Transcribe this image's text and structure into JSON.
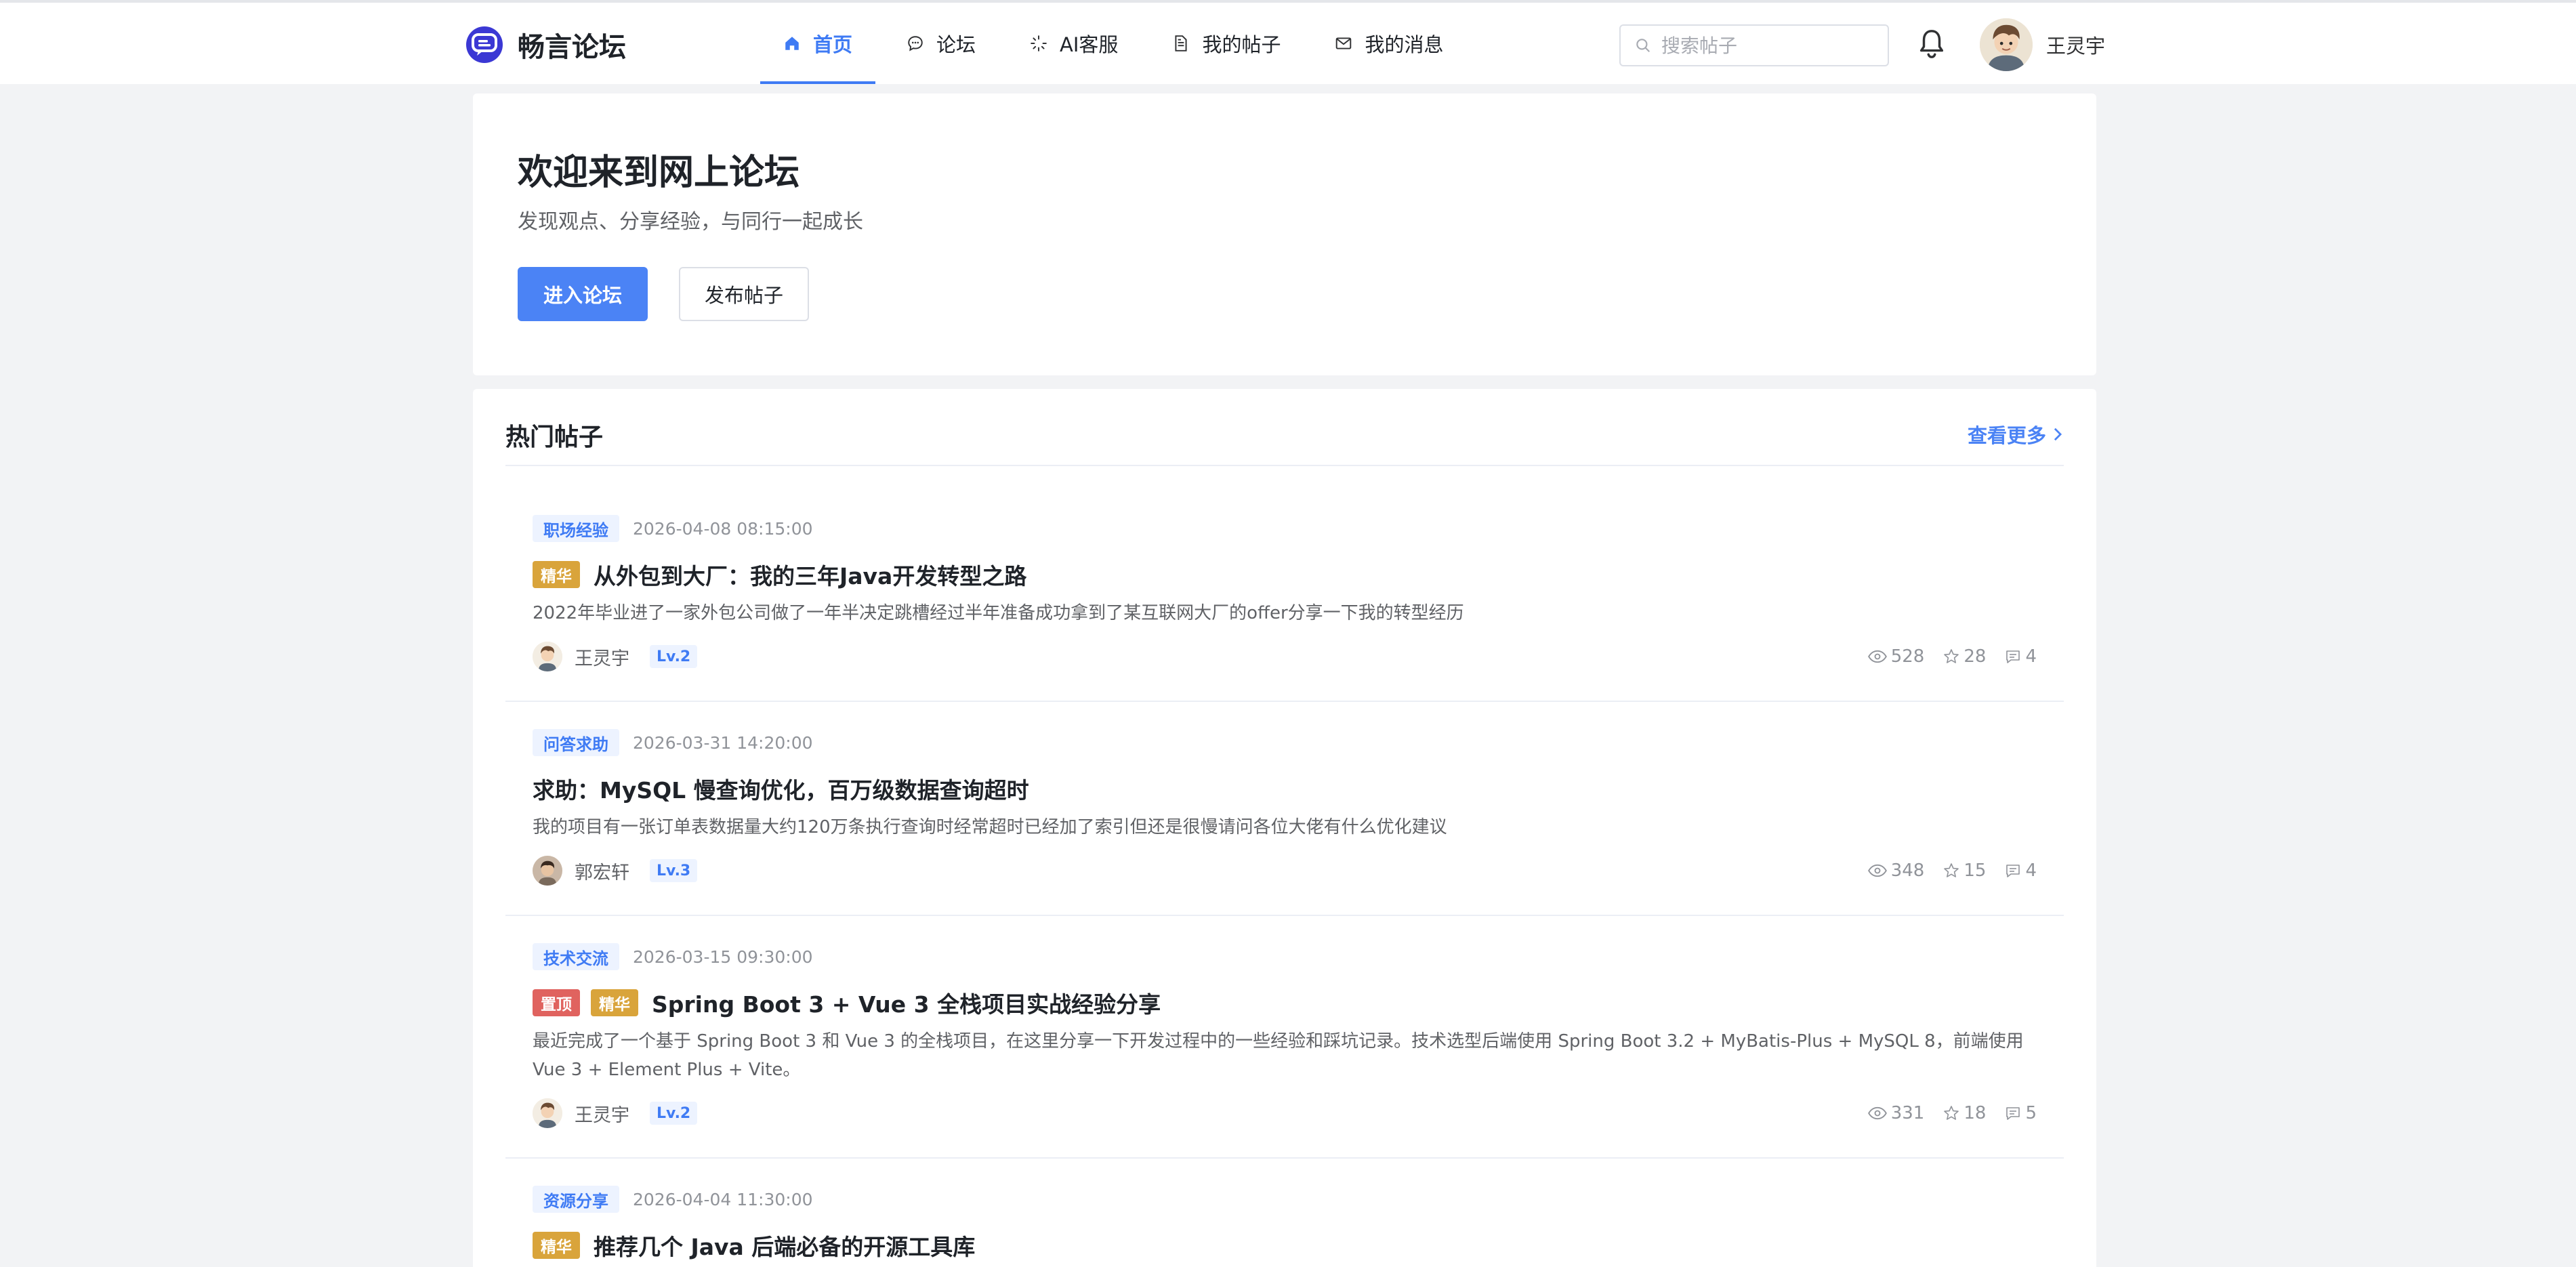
{
  "header": {
    "brand": "畅言论坛",
    "nav": [
      {
        "label": "首页",
        "icon": "home-icon",
        "active": true
      },
      {
        "label": "论坛",
        "icon": "chat-bubble-icon",
        "active": false
      },
      {
        "label": "AI客服",
        "icon": "sparkle-icon",
        "active": false
      },
      {
        "label": "我的帖子",
        "icon": "document-icon",
        "active": false
      },
      {
        "label": "我的消息",
        "icon": "mail-icon",
        "active": false
      }
    ],
    "search_placeholder": "搜索帖子",
    "user_name": "王灵宇"
  },
  "hero": {
    "title": "欢迎来到网上论坛",
    "subtitle": "发现观点、分享经验，与同行一起成长",
    "primary_button": "进入论坛",
    "secondary_button": "发布帖子"
  },
  "hot": {
    "title": "热门帖子",
    "more": "查看更多",
    "posts": [
      {
        "category": "职场经验",
        "date": "2026-04-08 08:15:00",
        "tags": [
          "精华"
        ],
        "title": "从外包到大厂：我的三年Java开发转型之路",
        "excerpt": "2022年毕业进了一家外包公司做了一年半决定跳槽经过半年准备成功拿到了某互联网大厂的offer分享一下我的转型经历",
        "author": "王灵宇",
        "level": "Lv.2",
        "views": "528",
        "stars": "28",
        "comments": "4"
      },
      {
        "category": "问答求助",
        "date": "2026-03-31 14:20:00",
        "tags": [],
        "title": "求助：MySQL 慢查询优化，百万级数据查询超时",
        "excerpt": "我的项目有一张订单表数据量大约120万条执行查询时经常超时已经加了索引但还是很慢请问各位大佬有什么优化建议",
        "author": "郭宏轩",
        "level": "Lv.3",
        "views": "348",
        "stars": "15",
        "comments": "4"
      },
      {
        "category": "技术交流",
        "date": "2026-03-15 09:30:00",
        "tags": [
          "置顶",
          "精华"
        ],
        "title": "Spring Boot 3 + Vue 3 全栈项目实战经验分享",
        "excerpt": "最近完成了一个基于 Spring Boot 3 和 Vue 3 的全栈项目，在这里分享一下开发过程中的一些经验和踩坑记录。技术选型后端使用 Spring Boot 3.2 + MyBatis-Plus + MySQL 8，前端使用 Vue 3 + Element Plus + Vite。",
        "author": "王灵宇",
        "level": "Lv.2",
        "views": "331",
        "stars": "18",
        "comments": "5"
      },
      {
        "category": "资源分享",
        "date": "2026-04-04 11:30:00",
        "tags": [
          "精华"
        ],
        "title": "推荐几个 Java 后端必备的开源工具库"
      }
    ]
  }
}
